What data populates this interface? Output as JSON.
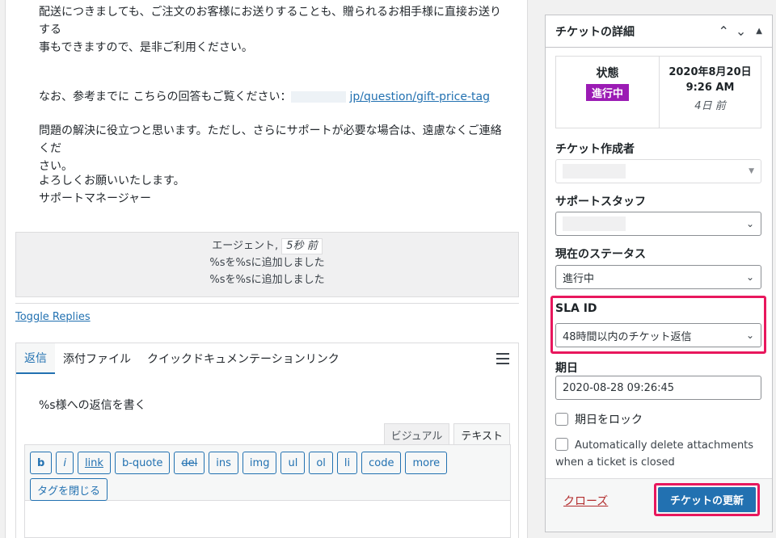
{
  "message": {
    "line1": "配送につきましても、ご注文のお客様にお送りすることも、贈られるお相手様に直接お送りする",
    "line2": "事もできますので、是非ご利用ください。",
    "ref_prefix": "なお、参考までに こちらの回答もご覧ください：",
    "ref_link": "jp/question/gift-price-tag",
    "para3_line1": "問題の解決に役立つと思います。ただし、さらにサポートが必要な場合は、遠慮なくご連絡くだ",
    "para3_line2": "さい。",
    "closing": "よろしくお願いいたします。",
    "signature": "サポートマネージャー"
  },
  "meta": {
    "agent": "エージェント,",
    "time_ago": "5秒 前",
    "added1": "%sを%sに追加しました",
    "added2": "%sを%sに追加しました"
  },
  "toggle_replies": "Toggle Replies",
  "tabs": [
    "返信",
    "添付ファイル",
    "クイックドキュメンテーションリンク"
  ],
  "reply_label": "%s様への返信を書く",
  "editor_modes": {
    "visual": "ビジュアル",
    "text": "テキスト"
  },
  "toolbar": [
    "b",
    "i",
    "link",
    "b-quote",
    "del",
    "ins",
    "img",
    "ul",
    "ol",
    "li",
    "code",
    "more",
    "タグを閉じる"
  ],
  "panel": {
    "title": "チケットの詳細",
    "status_label": "状態",
    "status_badge": "進行中",
    "date": "2020年8月20日",
    "time": "9:26 AM",
    "ago": "4日 前",
    "creator_label": "チケット作成者",
    "staff_label": "サポートスタッフ",
    "current_status_label": "現在のステータス",
    "current_status_value": "進行中",
    "sla_label": "SLA ID",
    "sla_value": "48時間以内のチケット返信",
    "due_label": "期日",
    "due_value": "2020-08-28 09:26:45",
    "lock_due": "期日をロック",
    "auto_delete": "Automatically delete attachments when a ticket is closed",
    "close_link": "クローズ",
    "update_button": "チケットの更新"
  },
  "colors": {
    "accent": "#2271b1",
    "badge": "#9b1bb4",
    "highlight": "#e8175d",
    "danger": "#b32d2e"
  }
}
